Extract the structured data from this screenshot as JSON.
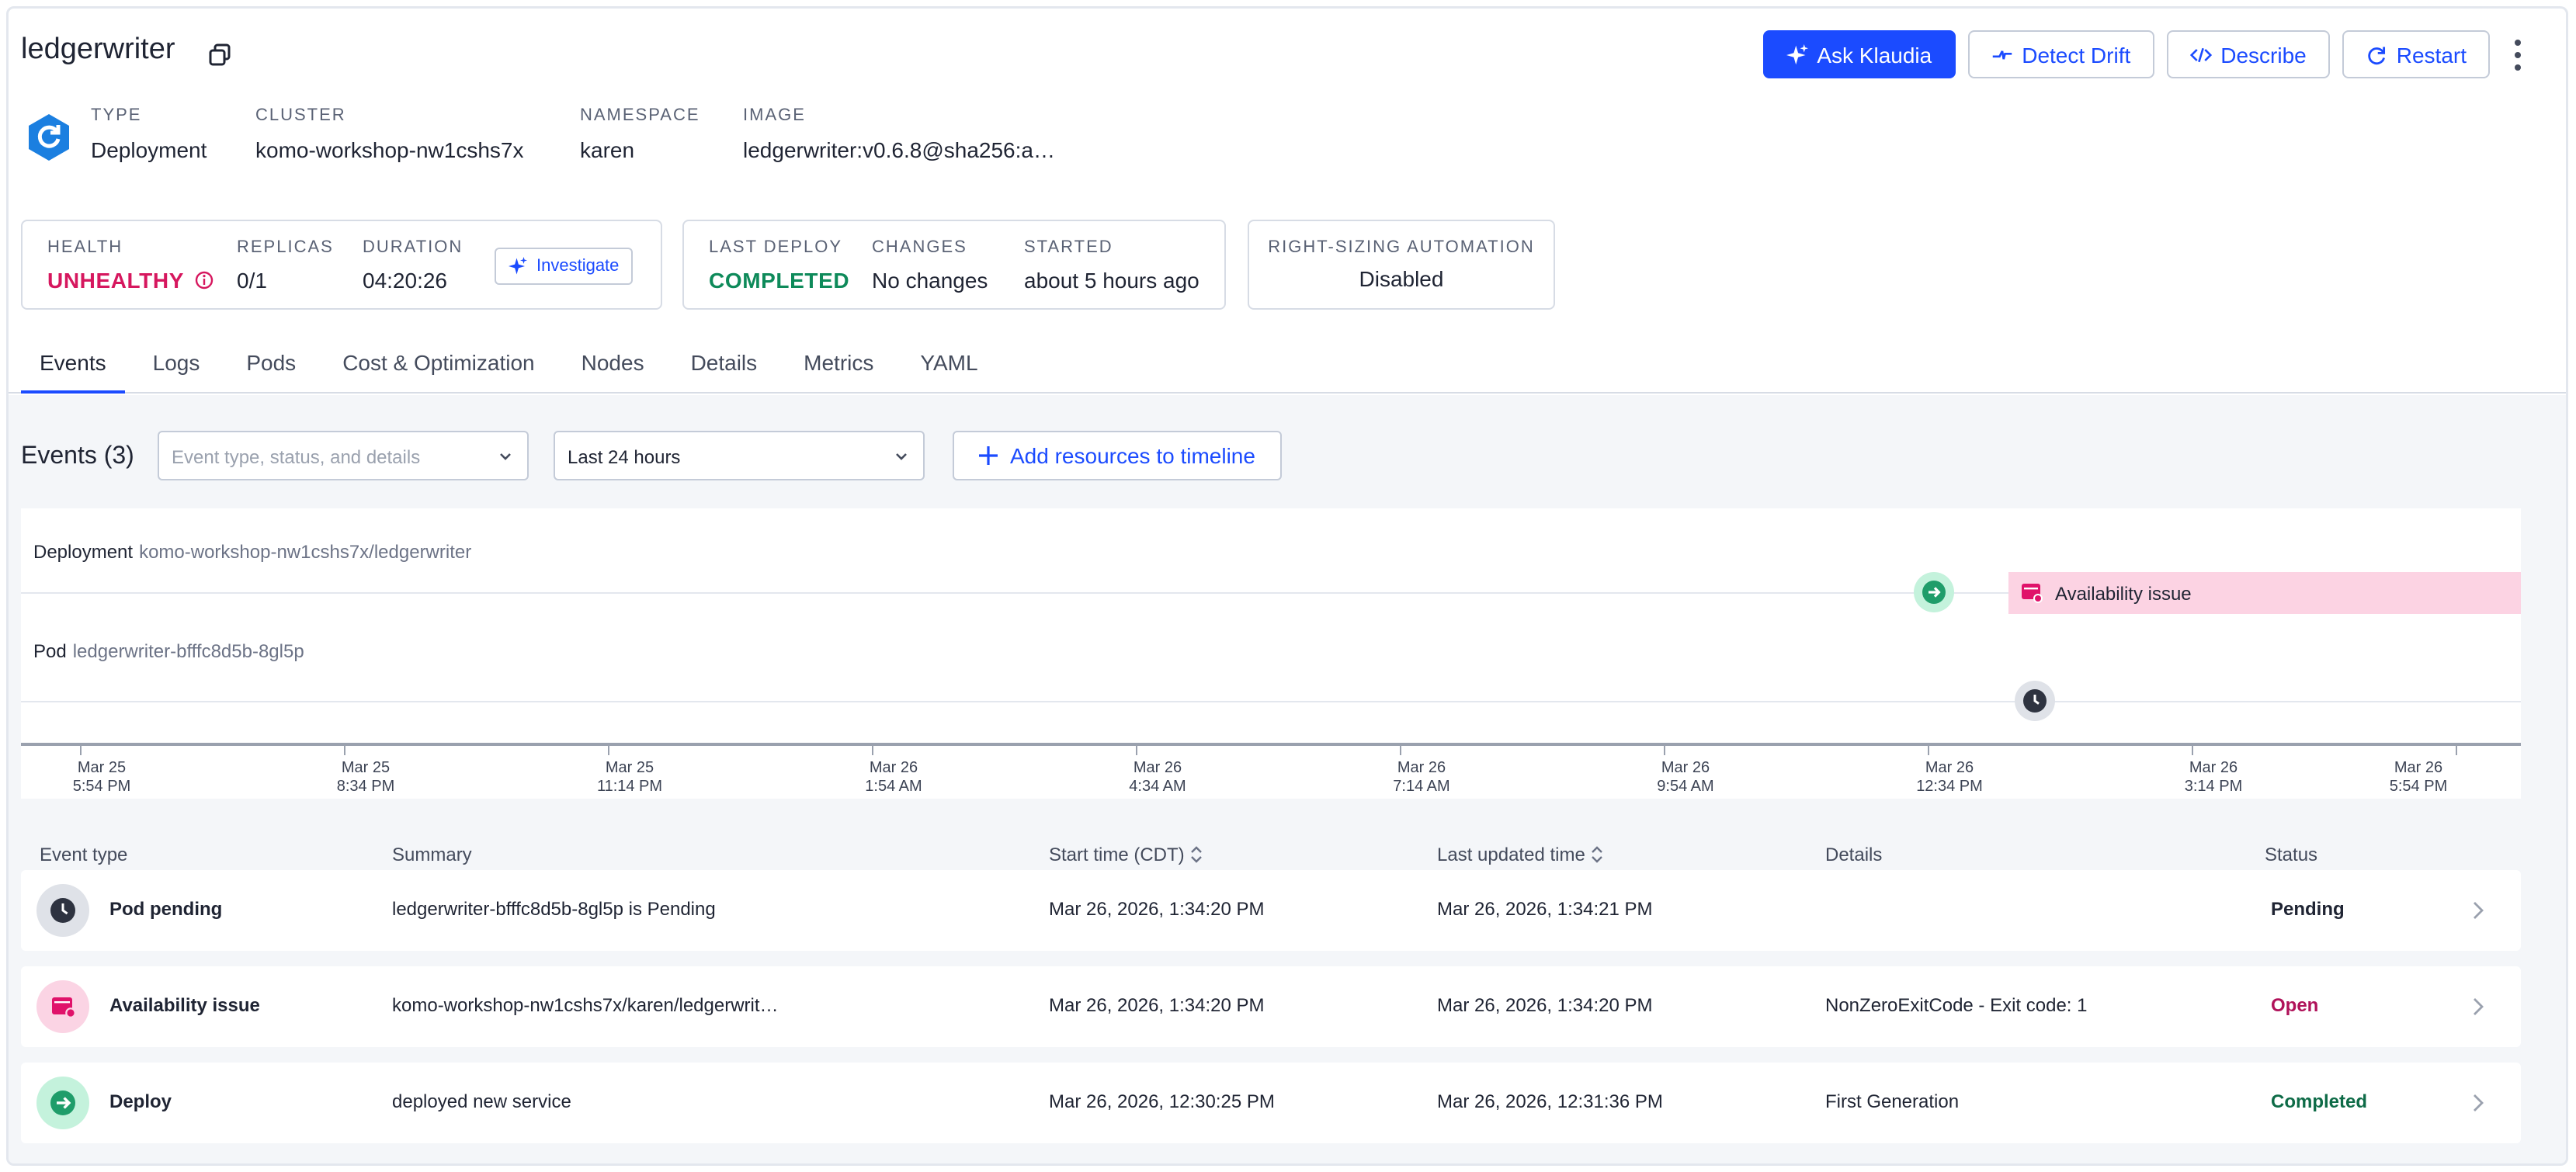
{
  "header": {
    "title": "ledgerwriter",
    "actions": {
      "ask": "Ask Klaudia",
      "drift": "Detect Drift",
      "describe": "Describe",
      "restart": "Restart"
    }
  },
  "meta": {
    "type": {
      "label": "TYPE",
      "value": "Deployment"
    },
    "cluster": {
      "label": "CLUSTER",
      "value": "komo-workshop-nw1cshs7x"
    },
    "namespace": {
      "label": "NAMESPACE",
      "value": "karen"
    },
    "image": {
      "label": "IMAGE",
      "value": "ledgerwriter:v0.6.8@sha256:a…"
    }
  },
  "health_card": {
    "health": {
      "label": "HEALTH",
      "value": "UNHEALTHY"
    },
    "replicas": {
      "label": "REPLICAS",
      "value": "0/1"
    },
    "duration": {
      "label": "DURATION",
      "value": "04:20:26"
    },
    "investigate": "Investigate"
  },
  "deploy_card": {
    "last_deploy": {
      "label": "LAST DEPLOY",
      "value": "COMPLETED"
    },
    "changes": {
      "label": "CHANGES",
      "value": "No changes"
    },
    "started": {
      "label": "STARTED",
      "value": "about 5 hours ago"
    }
  },
  "rightsizing_card": {
    "label": "RIGHT-SIZING AUTOMATION",
    "value": "Disabled"
  },
  "tabs": [
    "Events",
    "Logs",
    "Pods",
    "Cost & Optimization",
    "Nodes",
    "Details",
    "Metrics",
    "YAML"
  ],
  "events": {
    "title": "Events (3)",
    "filter_placeholder": "Event type, status, and details",
    "range": "Last 24 hours",
    "add_button": "Add resources to timeline"
  },
  "timeline": {
    "lanes": [
      {
        "kind": "Deployment",
        "name": "komo-workshop-nw1cshs7x/ledgerwriter"
      },
      {
        "kind": "Pod",
        "name": "ledgerwriter-bfffc8d5b-8gl5p"
      }
    ],
    "availability_label": "Availability issue",
    "ticks": [
      {
        "date": "Mar 25",
        "time": "5:54 PM"
      },
      {
        "date": "Mar 25",
        "time": "8:34 PM"
      },
      {
        "date": "Mar 25",
        "time": "11:14 PM"
      },
      {
        "date": "Mar 26",
        "time": "1:54 AM"
      },
      {
        "date": "Mar 26",
        "time": "4:34 AM"
      },
      {
        "date": "Mar 26",
        "time": "7:14 AM"
      },
      {
        "date": "Mar 26",
        "time": "9:54 AM"
      },
      {
        "date": "Mar 26",
        "time": "12:34 PM"
      },
      {
        "date": "Mar 26",
        "time": "3:14 PM"
      },
      {
        "date": "Mar 26",
        "time": "5:54 PM"
      }
    ]
  },
  "table": {
    "headers": {
      "type": "Event type",
      "summary": "Summary",
      "start": "Start time (CDT)",
      "updated": "Last updated time",
      "details": "Details",
      "status": "Status"
    },
    "rows": [
      {
        "type": "Pod pending",
        "summary": "ledgerwriter-bfffc8d5b-8gl5p is Pending",
        "start": "Mar 26, 2026, 1:34:20 PM",
        "updated": "Mar 26, 2026, 1:34:21 PM",
        "details": "",
        "status": "Pending"
      },
      {
        "type": "Availability issue",
        "summary": "komo-workshop-nw1cshs7x/karen/ledgerwrit…",
        "start": "Mar 26, 2026, 1:34:20 PM",
        "updated": "Mar 26, 2026, 1:34:20 PM",
        "details": "NonZeroExitCode - Exit code: 1",
        "status": "Open"
      },
      {
        "type": "Deploy",
        "summary": "deployed new service",
        "start": "Mar 26, 2026, 12:30:25 PM",
        "updated": "Mar 26, 2026, 12:31:36 PM",
        "details": "First Generation",
        "status": "Completed"
      }
    ]
  },
  "colors": {
    "accent": "#1b4bff",
    "unhealthy": "#d6175e",
    "completed": "#0e8a5a",
    "availability": "#fcd3e3"
  }
}
